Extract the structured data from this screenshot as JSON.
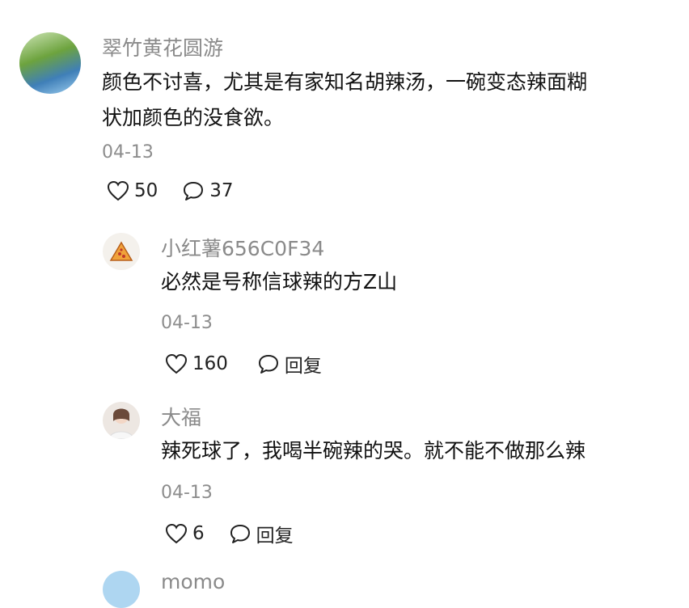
{
  "comment": {
    "username": "翠竹黄花圆游",
    "text_line1": "颜色不讨喜，尤其是有家知名胡辣汤，一碗变态辣面糊",
    "text_line2": "状加颜色的没食欲。",
    "date": "04-13",
    "likes": "50",
    "replies": "37"
  },
  "replies": [
    {
      "username": "小红薯656C0F34",
      "text": "必然是号称信球辣的方Z山",
      "date": "04-13",
      "likes": "160",
      "reply_label": "回复"
    },
    {
      "username": "大福",
      "text": "辣死球了，我喝半碗辣的哭。就不能不做那么辣",
      "date": "04-13",
      "likes": "6",
      "reply_label": "回复"
    },
    {
      "username": "momo"
    }
  ]
}
